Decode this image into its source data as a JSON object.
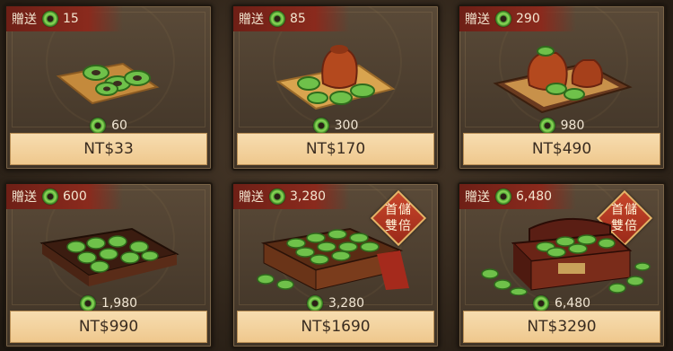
{
  "shop": {
    "bonus_label": "贈送",
    "icon": "jade-coin-icon",
    "badge_line1": "首儲",
    "badge_line2": "雙倍",
    "items": [
      {
        "bonus": "15",
        "amount": "60",
        "price": "NT$33"
      },
      {
        "bonus": "85",
        "amount": "300",
        "price": "NT$170"
      },
      {
        "bonus": "290",
        "amount": "980",
        "price": "NT$490"
      },
      {
        "bonus": "600",
        "amount": "1,980",
        "price": "NT$990"
      },
      {
        "bonus": "3,280",
        "amount": "3,280",
        "price": "NT$1690"
      },
      {
        "bonus": "6,480",
        "amount": "6,480",
        "price": "NT$3290"
      }
    ]
  },
  "colors": {
    "accent_red": "#8a2a1d",
    "jade_green": "#6fc14a",
    "price_bar": "#f2cf98"
  }
}
